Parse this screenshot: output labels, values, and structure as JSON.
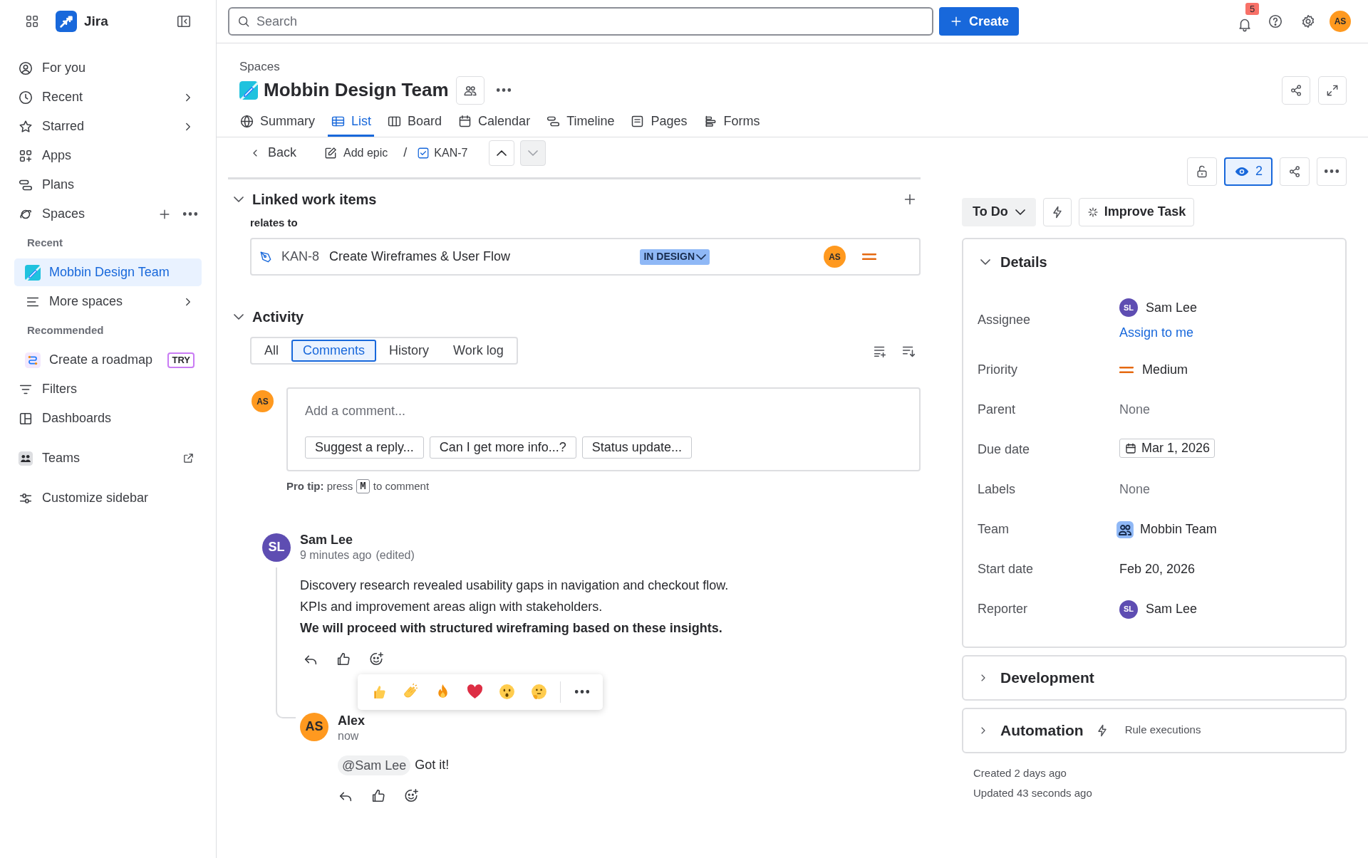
{
  "sidebar": {
    "app_name": "Jira",
    "items": [
      {
        "kind": "nav",
        "label": "For you"
      },
      {
        "kind": "nav",
        "label": "Recent",
        "chevron": true
      },
      {
        "kind": "nav",
        "label": "Starred",
        "chevron": true
      },
      {
        "kind": "nav",
        "label": "Apps"
      },
      {
        "kind": "nav",
        "label": "Plans"
      },
      {
        "kind": "nav",
        "label": "Spaces",
        "actions": true
      },
      {
        "kind": "heading",
        "label": "Recent"
      },
      {
        "kind": "space",
        "label": "Mobbin Design Team",
        "selected": true
      },
      {
        "kind": "sub",
        "label": "More spaces",
        "chevron": true
      },
      {
        "kind": "heading",
        "label": "Recommended"
      },
      {
        "kind": "promo",
        "label": "Create a roadmap",
        "badge": "TRY"
      },
      {
        "kind": "nav",
        "label": "Filters"
      },
      {
        "kind": "nav",
        "label": "Dashboards"
      },
      {
        "kind": "nav",
        "label": "Teams",
        "external": true
      },
      {
        "kind": "nav",
        "label": "Customize sidebar"
      }
    ]
  },
  "top_bar": {
    "search": {
      "placeholder": "Search"
    },
    "create": "Create",
    "notifications": "5",
    "avatar": "AS"
  },
  "page": {
    "breadcrumb": "Spaces",
    "title": "Mobbin Design Team",
    "tabs": [
      {
        "label": "Summary",
        "selected": false
      },
      {
        "label": "List",
        "selected": true
      },
      {
        "label": "Board",
        "selected": false
      },
      {
        "label": "Calendar",
        "selected": false
      },
      {
        "label": "Timeline",
        "selected": false
      },
      {
        "label": "Pages",
        "selected": false
      },
      {
        "label": "Forms",
        "selected": false
      }
    ]
  },
  "issue_nav": {
    "back": "Back",
    "add_epic": "Add epic",
    "separator": "/",
    "key": "KAN-7",
    "steps": [
      {
        "disabled": false
      },
      {
        "disabled": true
      }
    ]
  },
  "linked": {
    "title": "Linked work items",
    "expanded": true,
    "relation": "relates to",
    "items": [
      {
        "key": "KAN-8",
        "summary": "Create Wireframes & User Flow",
        "status": "IN DESIGN",
        "assignee": "AS"
      }
    ]
  },
  "activity": {
    "title": "Activity",
    "expanded": true,
    "tabs": [
      {
        "label": "All",
        "selected": false
      },
      {
        "label": "Comments",
        "selected": true
      },
      {
        "label": "History",
        "selected": false
      },
      {
        "label": "Work log",
        "selected": false
      }
    ],
    "composer": {
      "avatar": "AS",
      "placeholder": "Add a comment...",
      "suggestions": [
        "Suggest a reply...",
        "Can I get more info...?",
        "Status update..."
      ]
    },
    "pro_tip": {
      "lead": "**Pro tip:** press",
      "key": "M",
      "tail": "to comment"
    },
    "comments": [
      {
        "initials": "SL",
        "color": "#5e4db2",
        "author": "Sam Lee",
        "time": "9 minutes ago",
        "edited": "(edited)",
        "lines": [
          {
            "text": "Discovery research revealed usability gaps in navigation and checkout flow.",
            "bold": false
          },
          {
            "text": "KPIs and improvement areas align with stakeholders.",
            "bold": false
          },
          {
            "text": "We will proceed with structured wireframing based on these insights.",
            "bold": true
          }
        ],
        "reaction_picker_open": true,
        "replies": [
          {
            "initials": "AS",
            "color": "#ff991f",
            "author": "Alex",
            "time": "now",
            "mention": "@Sam Lee",
            "text": "Got it!"
          }
        ]
      }
    ]
  },
  "side": {
    "watchers": "2",
    "status": "To Do",
    "improve": "Improve Task",
    "details": {
      "title": "Details",
      "expanded": true,
      "fields": [
        {
          "kind": "person",
          "label": "Assignee",
          "value": "Sam Lee",
          "initials": "SL",
          "link": "Assign to me"
        },
        {
          "kind": "priority",
          "label": "Priority",
          "value": "Medium"
        },
        {
          "kind": "empty",
          "label": "Parent",
          "value": "None"
        },
        {
          "kind": "date",
          "label": "Due date",
          "value": "Mar 1, 2026"
        },
        {
          "kind": "empty",
          "label": "Labels",
          "value": "None"
        },
        {
          "kind": "team",
          "label": "Team",
          "value": "Mobbin Team"
        },
        {
          "kind": "text",
          "label": "Start date",
          "value": "Feb 20, 2026"
        },
        {
          "kind": "person",
          "label": "Reporter",
          "value": "Sam Lee",
          "initials": "SL"
        }
      ]
    },
    "panels": [
      {
        "title": "Development",
        "expanded": false
      },
      {
        "title": "Automation",
        "expanded": false,
        "note": "Rule executions"
      }
    ],
    "created": "Created 2 days ago",
    "updated": "Updated 43 seconds ago"
  }
}
